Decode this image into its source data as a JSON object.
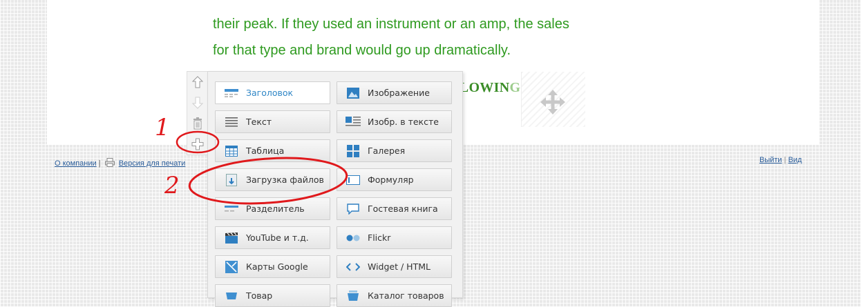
{
  "content": {
    "line1": "their peak. If they used an instrument or an amp, the sales",
    "line2": "for that type and brand would go up dramatically.",
    "heading_fragment": "HE FOLLOWIN",
    "heading_faded": "G"
  },
  "footer": {
    "company_link": "О компании",
    "separator": "|",
    "print_link": "Версия для печати",
    "logout_link": "Выйти",
    "separator2": "|",
    "view_link": "Вид"
  },
  "menu": {
    "items_left": [
      {
        "label": "Заголовок",
        "icon": "heading-icon"
      },
      {
        "label": "Текст",
        "icon": "text-icon"
      },
      {
        "label": "Таблица",
        "icon": "table-icon"
      },
      {
        "label": "Загрузка файлов",
        "icon": "file-upload-icon"
      },
      {
        "label": "Разделитель",
        "icon": "divider-icon"
      },
      {
        "label": "YouTube и т.д.",
        "icon": "video-icon"
      },
      {
        "label": "Карты Google",
        "icon": "map-icon"
      },
      {
        "label": "Товар",
        "icon": "product-icon"
      }
    ],
    "items_right": [
      {
        "label": "Изображение",
        "icon": "image-icon"
      },
      {
        "label": "Изобр. в тексте",
        "icon": "image-in-text-icon"
      },
      {
        "label": "Галерея",
        "icon": "gallery-icon"
      },
      {
        "label": "Формуляр",
        "icon": "form-icon"
      },
      {
        "label": "Гостевая книга",
        "icon": "guestbook-icon"
      },
      {
        "label": "Flickr",
        "icon": "flickr-icon"
      },
      {
        "label": "Widget / HTML",
        "icon": "widget-icon"
      },
      {
        "label": "Каталог товаров",
        "icon": "catalog-icon"
      }
    ]
  },
  "annotations": {
    "marker1": "1",
    "marker2": "2",
    "color": "#e0191c"
  },
  "colors": {
    "paragraph_green": "#2e9a1f",
    "active_blue": "#2f86c6",
    "link_blue": "#2a5d9a"
  }
}
